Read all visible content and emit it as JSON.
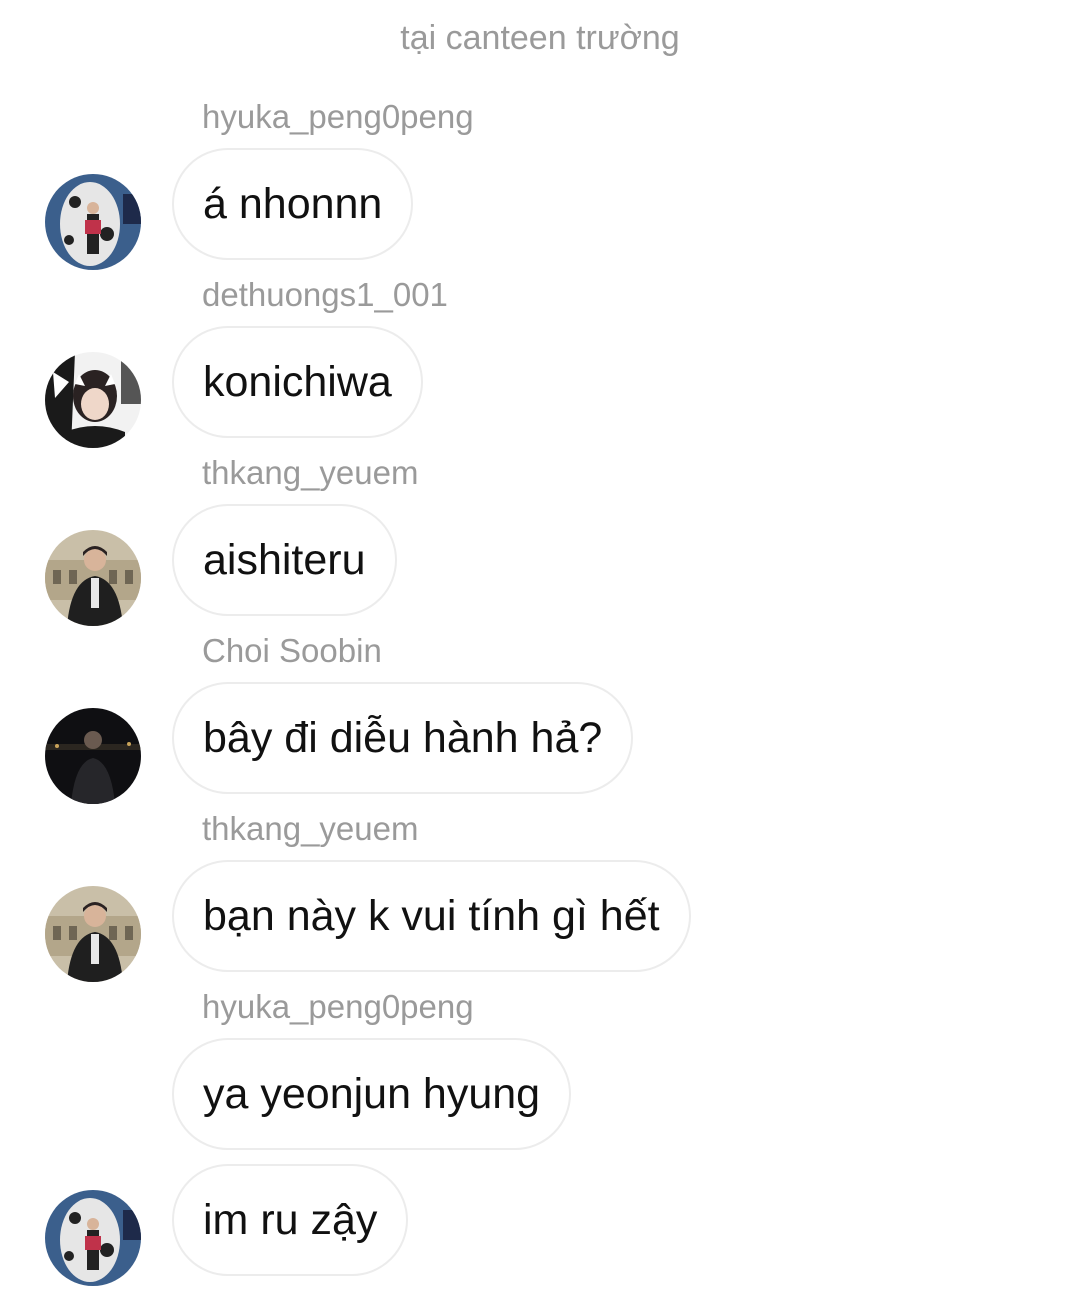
{
  "chat": {
    "header": "tại canteen trường",
    "messages": [
      {
        "sender": "hyuka_peng0peng",
        "text": "á nhonnn"
      },
      {
        "sender": "dethuongs1_001",
        "text": "konichiwa"
      },
      {
        "sender": "thkang_yeuem",
        "text": "aishiteru"
      },
      {
        "sender": "Choi Soobin",
        "text": "bây đi diễu hành hả?"
      },
      {
        "sender": "thkang_yeuem",
        "text": "bạn này k vui tính gì hết"
      },
      {
        "sender": "hyuka_peng0peng",
        "text": "ya yeonjun hyung"
      },
      {
        "sender": "",
        "text": "im ru zậy"
      }
    ]
  }
}
